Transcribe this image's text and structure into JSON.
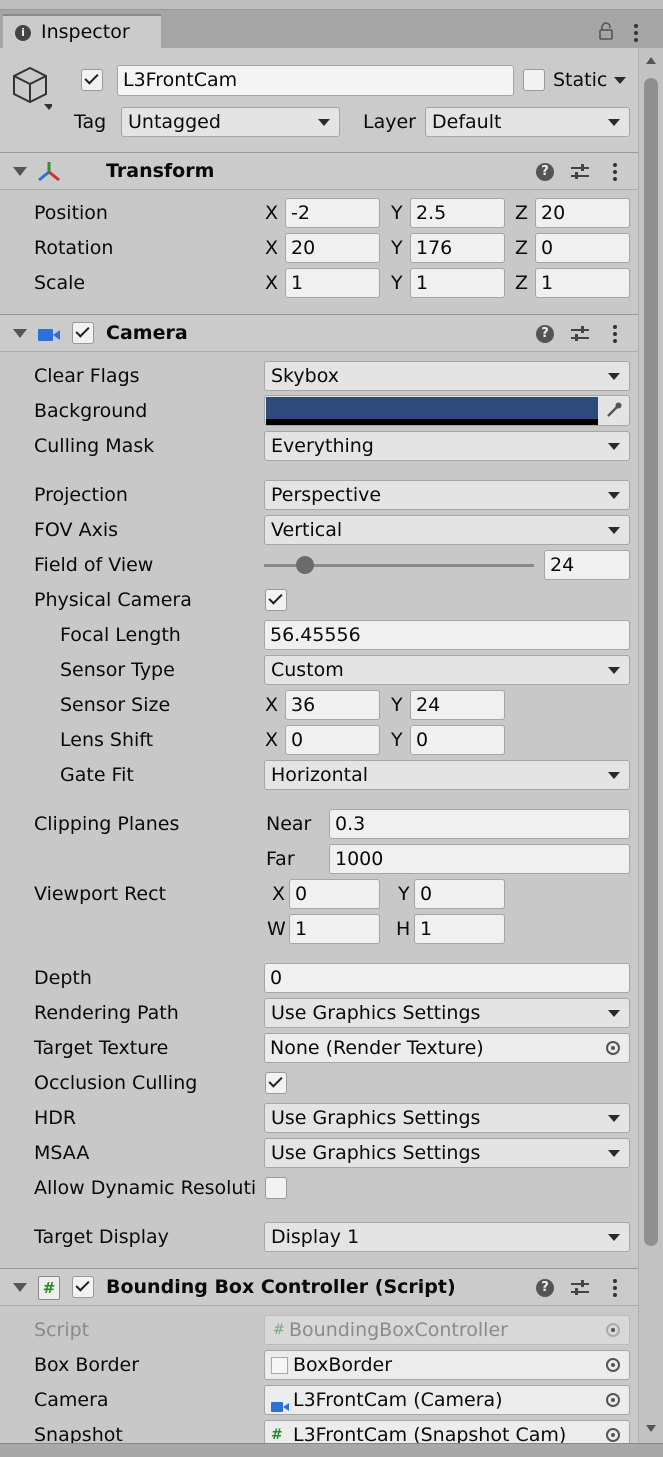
{
  "tab": {
    "title": "Inspector"
  },
  "object": {
    "name": "L3FrontCam",
    "active": true,
    "static_label": "Static",
    "tag_label": "Tag",
    "tag_value": "Untagged",
    "layer_label": "Layer",
    "layer_value": "Default"
  },
  "transform": {
    "title": "Transform",
    "position": {
      "label": "Position",
      "x": "-2",
      "y": "2.5",
      "z": "20"
    },
    "rotation": {
      "label": "Rotation",
      "x": "20",
      "y": "176",
      "z": "0"
    },
    "scale": {
      "label": "Scale",
      "x": "1",
      "y": "1",
      "z": "1"
    },
    "axis_x": "X",
    "axis_y": "Y",
    "axis_z": "Z"
  },
  "camera": {
    "title": "Camera",
    "enabled": true,
    "clear_flags": {
      "label": "Clear Flags",
      "value": "Skybox"
    },
    "background": {
      "label": "Background",
      "color": "#2d4a7a"
    },
    "culling_mask": {
      "label": "Culling Mask",
      "value": "Everything"
    },
    "projection": {
      "label": "Projection",
      "value": "Perspective"
    },
    "fov_axis": {
      "label": "FOV Axis",
      "value": "Vertical"
    },
    "field_of_view": {
      "label": "Field of View",
      "value": "24",
      "slider_fraction": 0.15
    },
    "physical_camera": {
      "label": "Physical Camera",
      "checked": true
    },
    "focal_length": {
      "label": "Focal Length",
      "value": "56.45556"
    },
    "sensor_type": {
      "label": "Sensor Type",
      "value": "Custom"
    },
    "sensor_size": {
      "label": "Sensor Size",
      "x": "36",
      "y": "24"
    },
    "lens_shift": {
      "label": "Lens Shift",
      "x": "0",
      "y": "0"
    },
    "gate_fit": {
      "label": "Gate Fit",
      "value": "Horizontal"
    },
    "clipping_planes": {
      "label": "Clipping Planes",
      "near_label": "Near",
      "near": "0.3",
      "far_label": "Far",
      "far": "1000"
    },
    "viewport_rect": {
      "label": "Viewport Rect",
      "x_label": "X",
      "x": "0",
      "y_label": "Y",
      "y": "0",
      "w_label": "W",
      "w": "1",
      "h_label": "H",
      "h": "1"
    },
    "depth": {
      "label": "Depth",
      "value": "0"
    },
    "rendering_path": {
      "label": "Rendering Path",
      "value": "Use Graphics Settings"
    },
    "target_texture": {
      "label": "Target Texture",
      "value": "None (Render Texture)"
    },
    "occlusion_culling": {
      "label": "Occlusion Culling",
      "checked": true
    },
    "hdr": {
      "label": "HDR",
      "value": "Use Graphics Settings"
    },
    "msaa": {
      "label": "MSAA",
      "value": "Use Graphics Settings"
    },
    "allow_dynamic": {
      "label": "Allow Dynamic Resoluti",
      "checked": false
    },
    "target_display": {
      "label": "Target Display",
      "value": "Display 1"
    }
  },
  "script_component": {
    "title": "Bounding Box Controller (Script)",
    "enabled": true,
    "script": {
      "label": "Script",
      "value": "BoundingBoxController"
    },
    "box_border": {
      "label": "Box Border",
      "value": "BoxBorder"
    },
    "camera": {
      "label": "Camera",
      "value": "L3FrontCam (Camera)"
    },
    "snapshot": {
      "label": "Snapshot",
      "value": "L3FrontCam (Snapshot Cam)"
    }
  },
  "colors": {
    "accent_blue": "#2f6fd6",
    "background_swatch": "#2d4a7a"
  }
}
